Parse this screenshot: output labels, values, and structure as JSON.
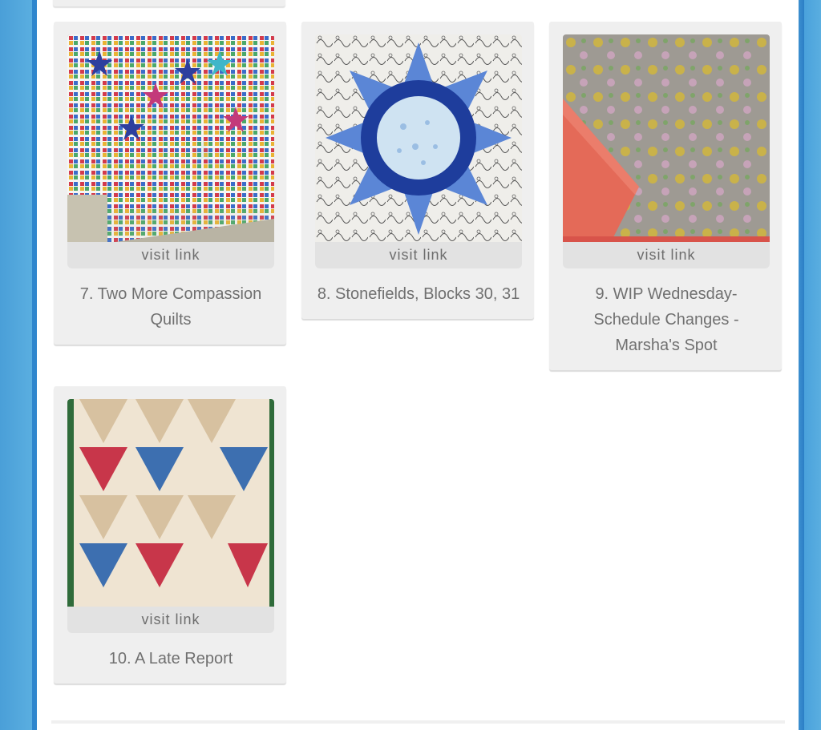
{
  "links": [
    {
      "visit_label": "visit link",
      "title": "7. Two More Compassion Quilts"
    },
    {
      "visit_label": "visit link",
      "title": "8. Stonefields, Blocks 30, 31"
    },
    {
      "visit_label": "visit link",
      "title": "9. WIP Wednesday- Schedule Changes - Marsha's Spot"
    },
    {
      "visit_label": "visit link",
      "title": "10. A Late Report"
    }
  ],
  "colors": {
    "side_blue": "#5aaee0",
    "card_bg": "#efefef",
    "visit_bg": "#e2e2e2",
    "text": "#707070"
  }
}
